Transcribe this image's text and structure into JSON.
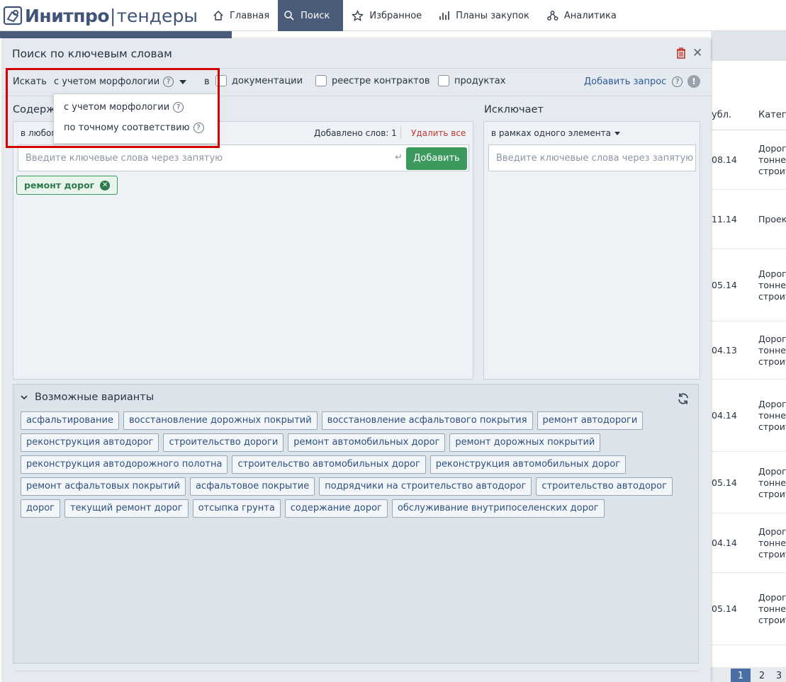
{
  "brand": {
    "name": "Инитпро",
    "separator": "|",
    "product": "тендеры"
  },
  "nav": [
    {
      "label": "Главная",
      "icon": "home-icon"
    },
    {
      "label": "Поиск",
      "icon": "search-icon",
      "active": true
    },
    {
      "label": "Избранное",
      "icon": "star-icon"
    },
    {
      "label": "Планы закупок",
      "icon": "bar-chart-icon"
    },
    {
      "label": "Аналитика",
      "icon": "network-icon"
    }
  ],
  "background": {
    "header_col1": "убл.",
    "header_col2": "Катег",
    "rows": [
      {
        "date": "08.14",
        "lines": [
          "Дорог",
          "тонне",
          "строит"
        ]
      },
      {
        "date": "11.14",
        "lines": [
          "Проек"
        ]
      },
      {
        "date": "05.14",
        "lines": [
          "Дорог",
          "тонне",
          "строит"
        ]
      },
      {
        "date": "04.13",
        "lines": [
          "Дорог",
          "тонне",
          "строит"
        ]
      },
      {
        "date": "04.14",
        "lines": [
          "Дорог",
          "тонне",
          "строит"
        ]
      },
      {
        "date": "05.14",
        "lines": [
          "Дорог",
          "тонне",
          "строит"
        ]
      },
      {
        "date": "04.14",
        "lines": [
          "Дорог",
          "тонне",
          "строит"
        ]
      },
      {
        "date": "05.14",
        "lines": [
          "Дорог",
          "тонне",
          "строит"
        ]
      }
    ],
    "pager": [
      "1",
      "2",
      "3"
    ]
  },
  "modal": {
    "title": "Поиск по ключевым словам",
    "search_label": "Искать",
    "mode_selected": "с учетом морфологии",
    "in_label": "в",
    "checkboxes": [
      "документации",
      "реестре контрактов",
      "продуктах"
    ],
    "add_query": "Добавить запрос",
    "help_glyph": "?",
    "warning_glyph": "!",
    "dropdown_options": [
      "с учетом морфологии",
      "по точному соответствию"
    ],
    "contains": {
      "title": "Содерж",
      "scope": "в любом",
      "count": "Добавлено слов: 1",
      "delete_all": "Удалить все",
      "placeholder": "Введите ключевые слова через запятую",
      "enter_glyph": "↵",
      "add_button": "Добавить",
      "tags": [
        "ремонт дорог"
      ]
    },
    "excludes": {
      "title": "Исключает",
      "scope": "в рамках одного элемента",
      "placeholder": "Введите ключевые слова через запятую"
    },
    "suggestions": {
      "title": "Возможные варианты",
      "rows": [
        [
          "асфальтирование",
          "восстановление дорожных покрытий",
          "восстановление асфальтового покрытия",
          "ремонт автодороги"
        ],
        [
          "реконструкция автодорог",
          "строительство дороги",
          "ремонт автомобильных дорог",
          "ремонт дорожных покрытий"
        ],
        [
          "реконструкция автодорожного полотна",
          "строительство автомобильных дорог",
          "реконструкция автомобильных дорог"
        ],
        [
          "ремонт асфальтовых покрытий",
          "асфальтовое покрытие",
          "подрядчики на строительство автодорог",
          "строительство автодорог"
        ],
        [
          "дорог",
          "текущий ремонт дорог",
          "отсыпка грунта",
          "содержание дорог",
          "обслуживание внутрипоселенских дорог"
        ]
      ]
    }
  },
  "colors": {
    "accent": "#4b5c7b",
    "green": "#3d9a5e",
    "link": "#2d5b9a",
    "highlight": "#d40000"
  }
}
